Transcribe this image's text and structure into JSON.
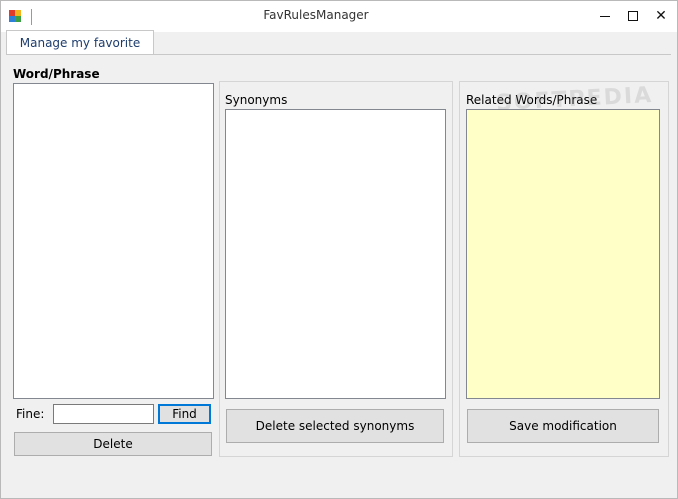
{
  "window": {
    "title": "FavRulesManager",
    "minimize_glyph": "",
    "maximize_glyph": "",
    "close_glyph": "✕"
  },
  "tabs": [
    {
      "label": "Manage my favorite rules",
      "active": true
    }
  ],
  "word_panel": {
    "label": "Word/Phrase",
    "items": [],
    "find_label": "Fine:",
    "find_value": "",
    "find_button": "Find",
    "delete_button": "Delete"
  },
  "synonyms_panel": {
    "label": "Synonyms",
    "items": [],
    "delete_button": "Delete selected synonyms"
  },
  "related_panel": {
    "label": "Related Words/Phrase",
    "value": "",
    "save_button": "Save modification",
    "background_color": "#ffffc8"
  },
  "watermark": "SOFTPEDIA"
}
